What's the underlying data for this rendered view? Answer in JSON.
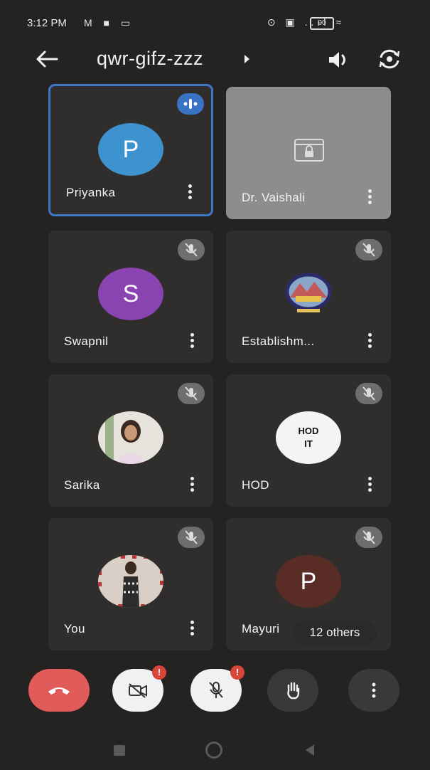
{
  "status_bar": {
    "time": "3:12 PM",
    "left_icons": "M ■ ▭",
    "right_icons": "⊙ ▣ ..ıl ≈",
    "battery": "90"
  },
  "header": {
    "meeting_code": "qwr-gifz-zzz",
    "back_icon": "arrow-left-icon",
    "speaker_icon": "speaker-icon",
    "flip_icon": "flip-camera-icon"
  },
  "participants": [
    {
      "name": "Priyanka",
      "initial": "P",
      "active": true
    },
    {
      "name": "Dr. Vaishali",
      "presenting": true
    },
    {
      "name": "Swapnil",
      "initial": "S"
    },
    {
      "name": "Establishm..."
    },
    {
      "name": "Sarika"
    },
    {
      "name": "HOD",
      "avatar_text": [
        "HOD",
        "IT"
      ]
    },
    {
      "name": "You"
    },
    {
      "name": "Mayuri",
      "initial": "P"
    }
  ],
  "others_chip": "12 others",
  "controls": {
    "end_call": "end-call-icon",
    "camera": "camera-off-icon",
    "mic": "mic-off-icon",
    "hand": "raise-hand-icon",
    "more": "more-vert-icon",
    "alert_mark": "!"
  },
  "colors": {
    "accent": "#3b78c8",
    "end_call": "#e25b5b",
    "alert": "#d8463a"
  }
}
